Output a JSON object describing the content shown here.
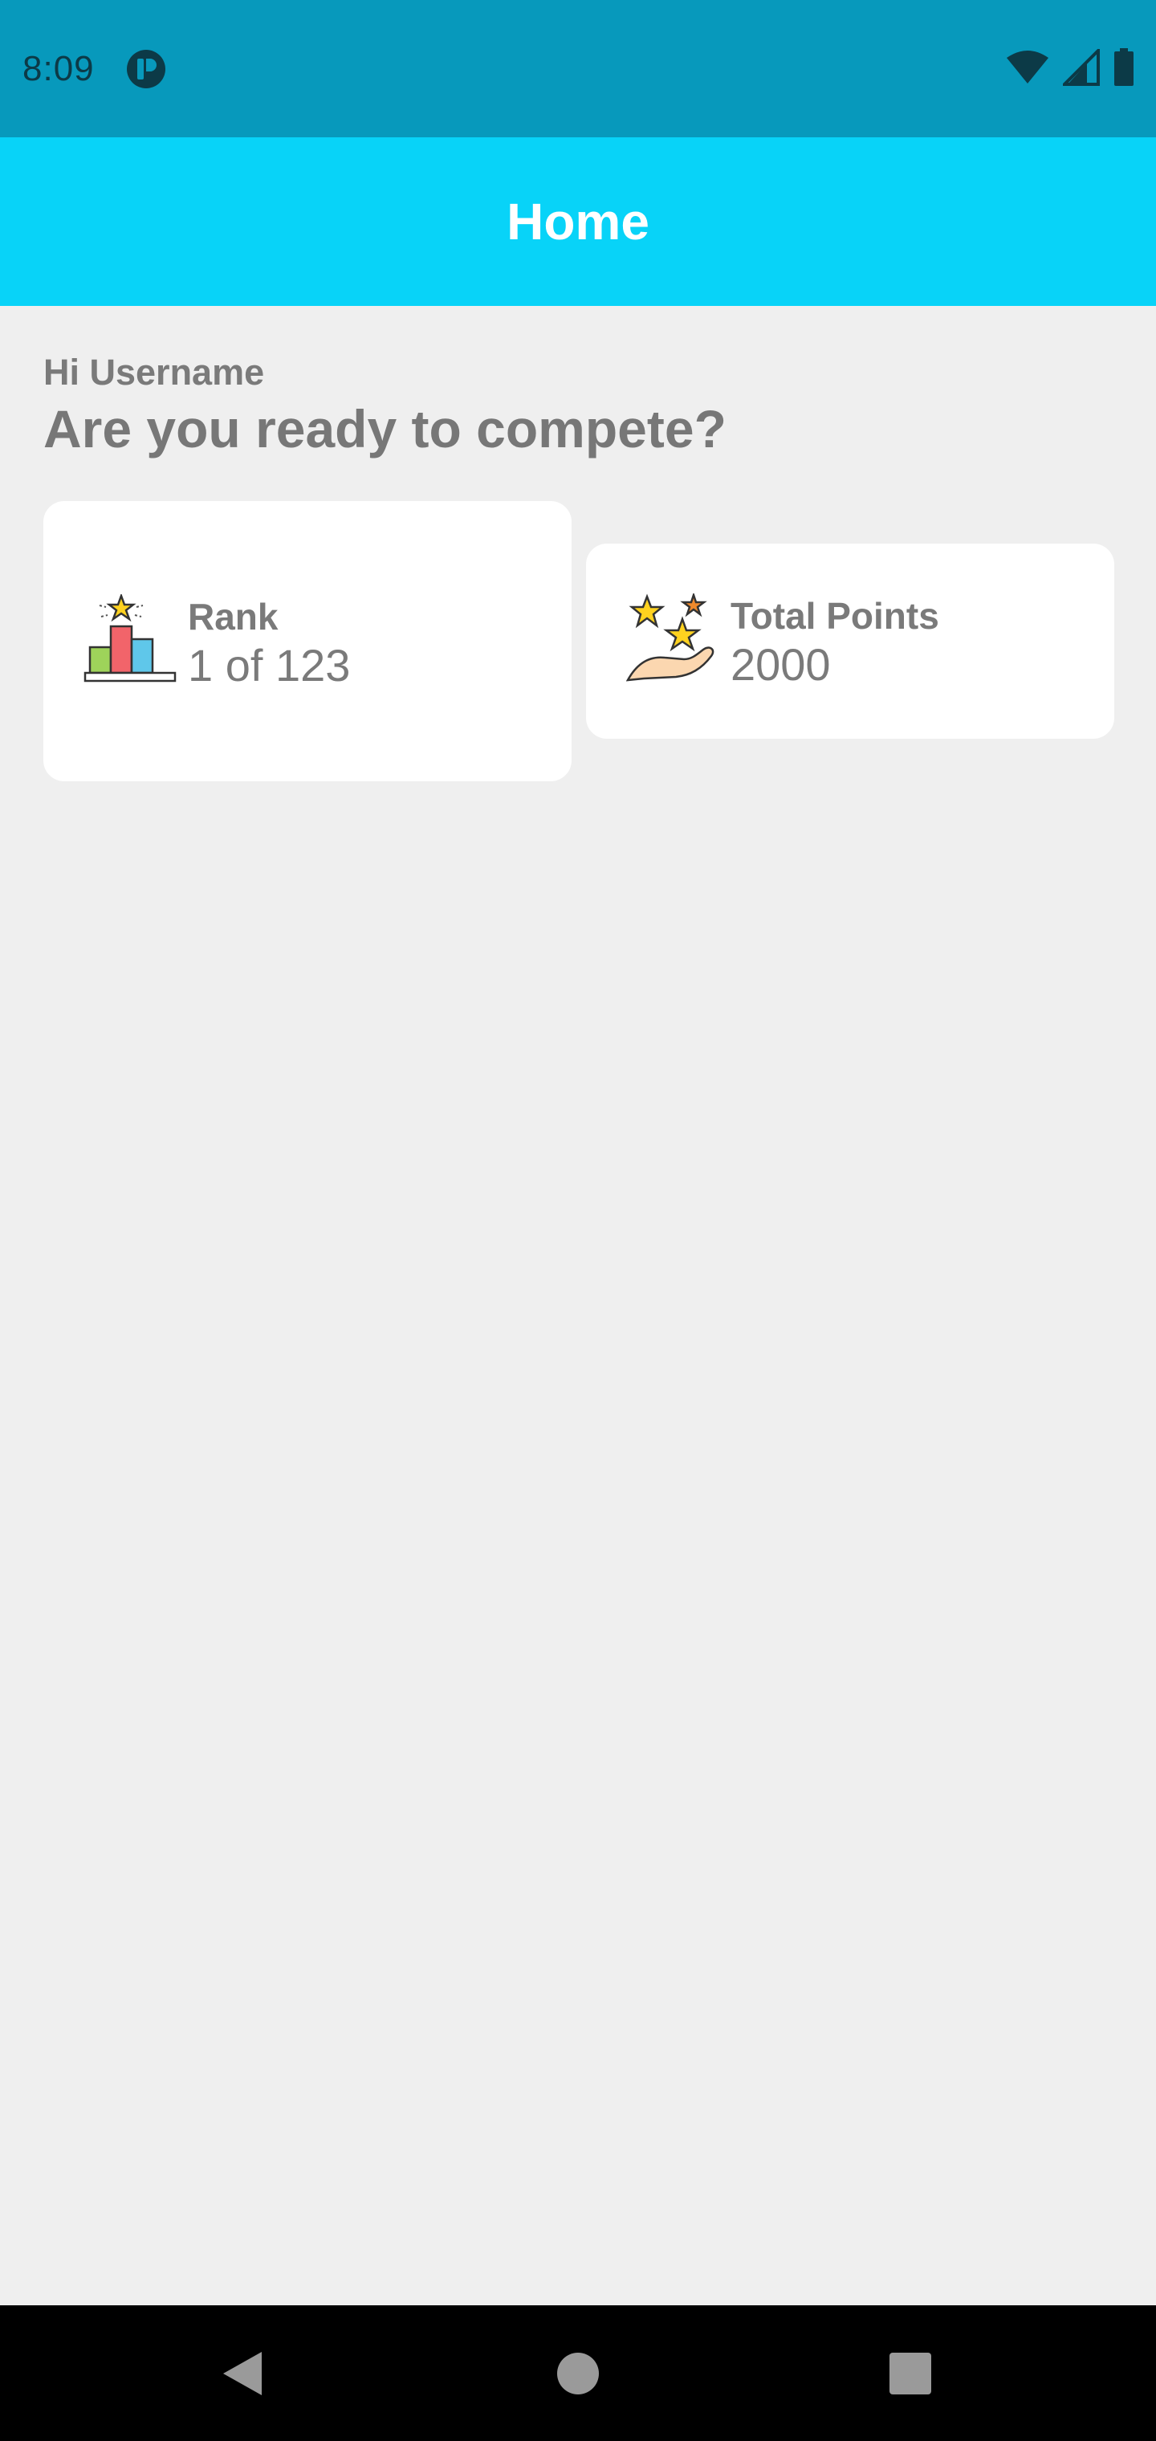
{
  "status_bar": {
    "time": "8:09",
    "icons": [
      "app-notification-icon",
      "wifi-icon",
      "signal-icon",
      "battery-icon"
    ],
    "background": "#0799bc"
  },
  "app_bar": {
    "title": "Home",
    "background": "#08d3f8"
  },
  "main": {
    "greeting": "Hi Username",
    "headline": "Are you ready to compete?",
    "cards": [
      {
        "icon": "podium-trophy-icon",
        "label": "Rank",
        "value": "1 of 123"
      },
      {
        "icon": "hand-stars-icon",
        "label": "Total Points",
        "value": "2000"
      }
    ]
  },
  "nav_bar": {
    "buttons": [
      "back-icon",
      "home-icon",
      "recents-icon"
    ]
  }
}
